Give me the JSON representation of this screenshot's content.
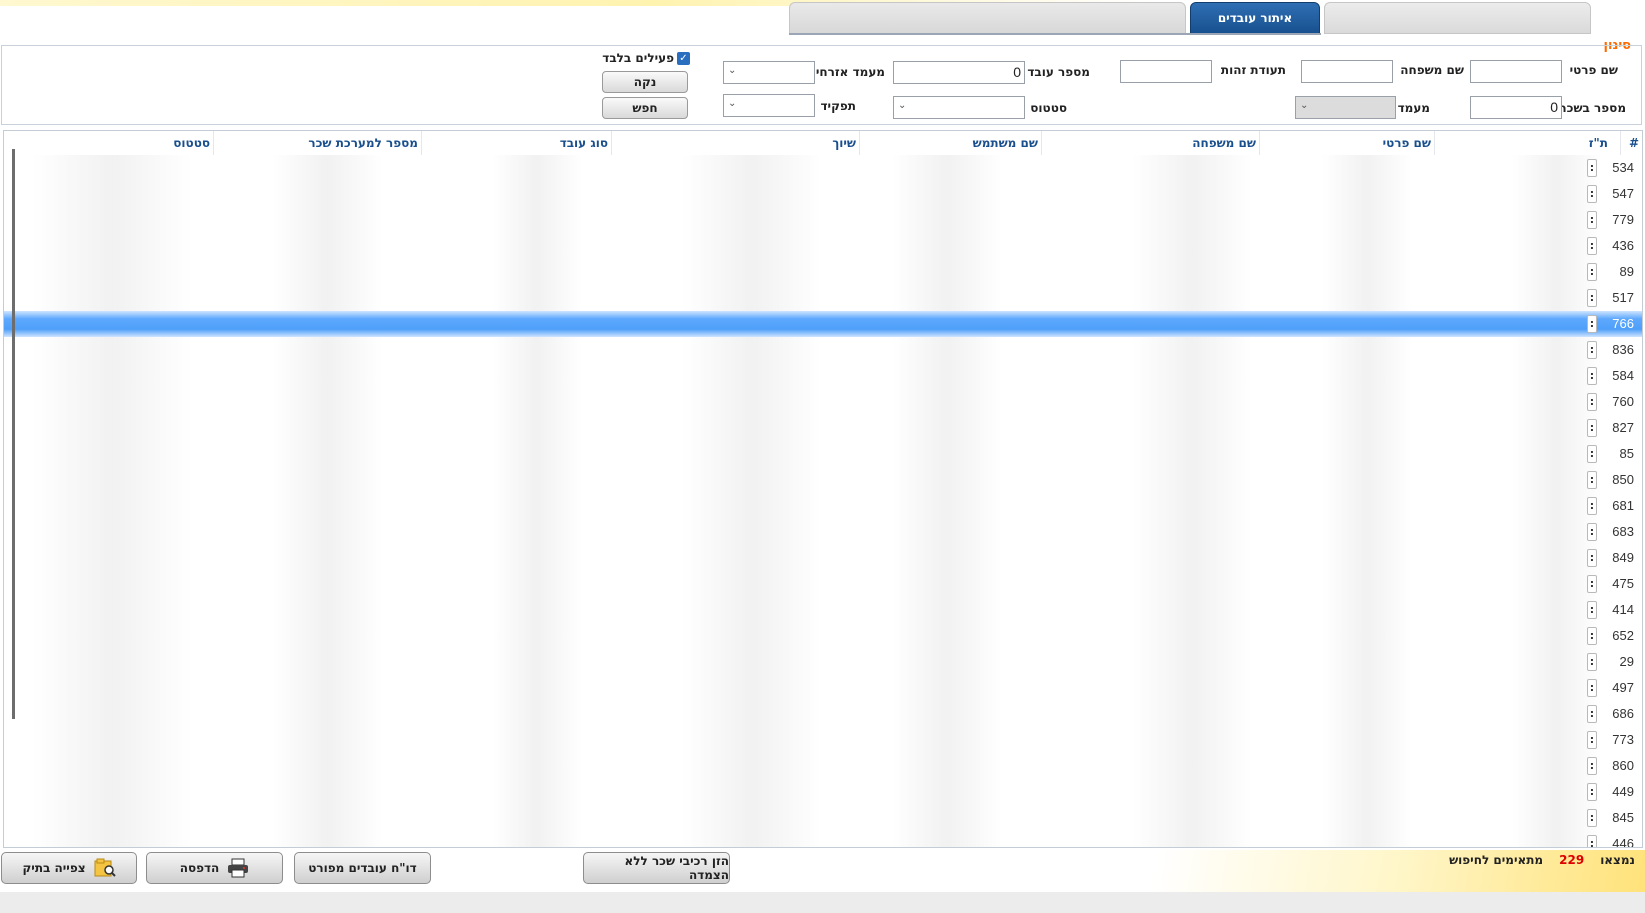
{
  "tabs": {
    "active_label": "איתור עובדים"
  },
  "filter": {
    "legend": "סינון",
    "first_name_label": "שם פרטי",
    "last_name_label": "שם משפחה",
    "id_label": "תעודת זהות",
    "employee_number_label": "מספר עובד",
    "employee_number_value": "0",
    "civil_status_label": "מעמד אזרחי",
    "active_only_label": "פעילים בלבד",
    "salary_number_label": "מספר בשכר",
    "salary_number_value": "0",
    "status_label": "מעמד",
    "state_label": "סטטוס",
    "role_label": "תפקיד",
    "clear_label": "נקה",
    "search_label": "חפש"
  },
  "grid": {
    "columns": [
      "#",
      "ת\"ז",
      "שם פרטי",
      "שם משפחה",
      "שם משתמש",
      "שיוך",
      "סוג עובד",
      "מספר למערכת שכר",
      "סטטוס"
    ],
    "rows": [
      "534",
      "547",
      "779",
      "436",
      "89",
      "517",
      "766",
      "836",
      "584",
      "760",
      "827",
      "85",
      "850",
      "681",
      "683",
      "849",
      "475",
      "414",
      "652",
      "29",
      "497",
      "686",
      "773",
      "860",
      "449",
      "845",
      "446"
    ],
    "selected_row": "766",
    "row_menu_glyph": ":"
  },
  "footer": {
    "found_label": "נמצאו",
    "found_count": "229",
    "found_suffix": "מתאימים לחיפוש",
    "btn_enter_salary": "הזן רכיבי שכר ללא הצמדה",
    "btn_detailed_report": "דו\"ח עובדים מפורט",
    "btn_print": "הדפסה",
    "btn_view_file": "צפייה בתיק"
  },
  "icons": {
    "printer": "printer-icon",
    "folder": "folder-search-icon",
    "checkbox": "checkbox-checked-icon",
    "chevron": "chevron-down-icon"
  },
  "colors": {
    "accent_orange": "#ff6a00",
    "header_blue": "#1a4f8e",
    "selection_blue": "#4e9ff8",
    "tab_blue": "#18508f"
  }
}
